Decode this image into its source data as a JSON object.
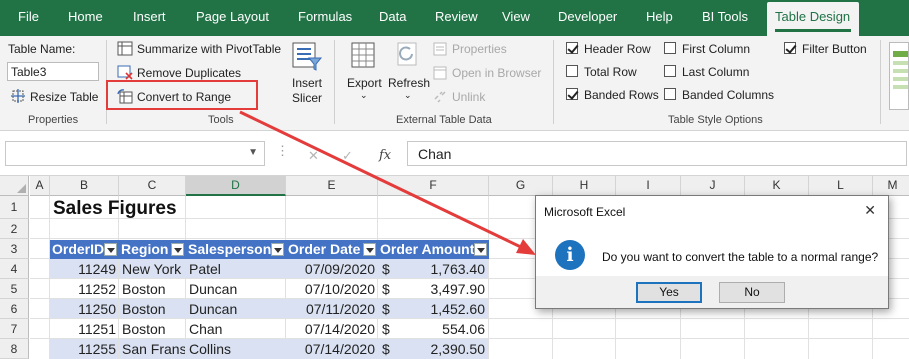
{
  "menu": {
    "tabs": [
      "File",
      "Home",
      "Insert",
      "Page Layout",
      "Formulas",
      "Data",
      "Review",
      "View",
      "Developer",
      "Help",
      "BI Tools",
      "Table Design"
    ],
    "active_tab": "Table Design"
  },
  "ribbon": {
    "properties": {
      "table_name_label": "Table Name:",
      "table_name_value": "Table3",
      "resize_table": "Resize Table",
      "group_label": "Properties"
    },
    "tools": {
      "summarize": "Summarize with PivotTable",
      "remove_duplicates": "Remove Duplicates",
      "convert_to_range": "Convert to Range",
      "insert_slicer_1": "Insert",
      "insert_slicer_2": "Slicer",
      "group_label": "Tools"
    },
    "external": {
      "export": "Export",
      "refresh": "Refresh",
      "properties": "Properties",
      "open_in_browser": "Open in Browser",
      "unlink": "Unlink",
      "group_label": "External Table Data"
    },
    "style_options": {
      "header_row": "Header Row",
      "total_row": "Total Row",
      "banded_rows": "Banded Rows",
      "first_column": "First Column",
      "last_column": "Last Column",
      "banded_columns": "Banded Columns",
      "filter_button": "Filter Button",
      "group_label": "Table Style Options",
      "checked": {
        "header_row": true,
        "total_row": false,
        "banded_rows": true,
        "first_column": false,
        "last_column": false,
        "banded_columns": false,
        "filter_button": true
      }
    }
  },
  "formula_bar": {
    "name_box": "",
    "fx": "fx",
    "value": "Chan"
  },
  "sheet": {
    "columns": [
      "A",
      "B",
      "C",
      "D",
      "E",
      "F",
      "G",
      "H",
      "I",
      "J",
      "K",
      "L",
      "M"
    ],
    "selected_column": "D",
    "rows": [
      "1",
      "2",
      "3",
      "4",
      "5",
      "6",
      "7",
      "8"
    ],
    "title": "Sales Figures",
    "headers": [
      "OrderID",
      "Region",
      "Salesperson",
      "Order Date",
      "Order Amount"
    ],
    "data": [
      {
        "id": "11249",
        "region": "New York",
        "person": "Patel",
        "date": "07/09/2020",
        "cur": "$",
        "amount": "1,763.40"
      },
      {
        "id": "11252",
        "region": "Boston",
        "person": "Duncan",
        "date": "07/10/2020",
        "cur": "$",
        "amount": "3,497.90"
      },
      {
        "id": "11250",
        "region": "Boston",
        "person": "Duncan",
        "date": "07/11/2020",
        "cur": "$",
        "amount": "1,452.60"
      },
      {
        "id": "11251",
        "region": "Boston",
        "person": "Chan",
        "date": "07/14/2020",
        "cur": "$",
        "amount": "554.06"
      },
      {
        "id": "11255",
        "region": "San Fransi",
        "person": "Collins",
        "date": "07/14/2020",
        "cur": "$",
        "amount": "2,390.50"
      }
    ]
  },
  "dialog": {
    "title": "Microsoft Excel",
    "close": "✕",
    "message": "Do you want to convert the table to a normal range?",
    "yes": "Yes",
    "no": "No",
    "icon": "i"
  },
  "colors": {
    "excel_green": "#217346",
    "table_header": "#4472c4",
    "band": "#d9e1f2",
    "annotation_red": "#e43b3b",
    "info_blue": "#1e73be"
  }
}
